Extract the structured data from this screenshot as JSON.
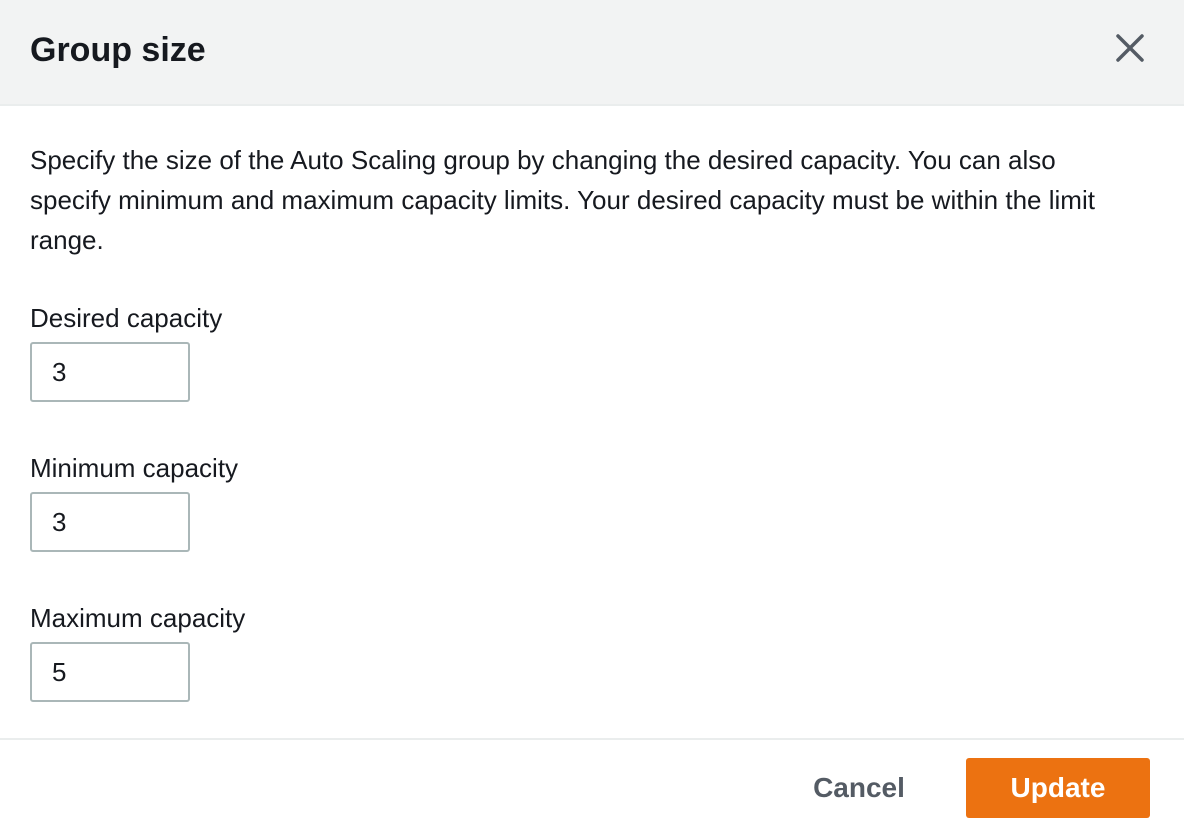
{
  "header": {
    "title": "Group size",
    "close_icon": "close-icon"
  },
  "body": {
    "description": "Specify the size of the Auto Scaling group by changing the desired capacity. You can also specify minimum and maximum capacity limits. Your desired capacity must be within the limit range.",
    "fields": {
      "desired": {
        "label": "Desired capacity",
        "value": "3"
      },
      "minimum": {
        "label": "Minimum capacity",
        "value": "3"
      },
      "maximum": {
        "label": "Maximum capacity",
        "value": "5"
      }
    }
  },
  "footer": {
    "cancel_label": "Cancel",
    "update_label": "Update"
  },
  "colors": {
    "header_background": "#f2f3f3",
    "primary_button": "#ec7211",
    "cancel_text": "#545b64",
    "input_border": "#aab7b8"
  }
}
